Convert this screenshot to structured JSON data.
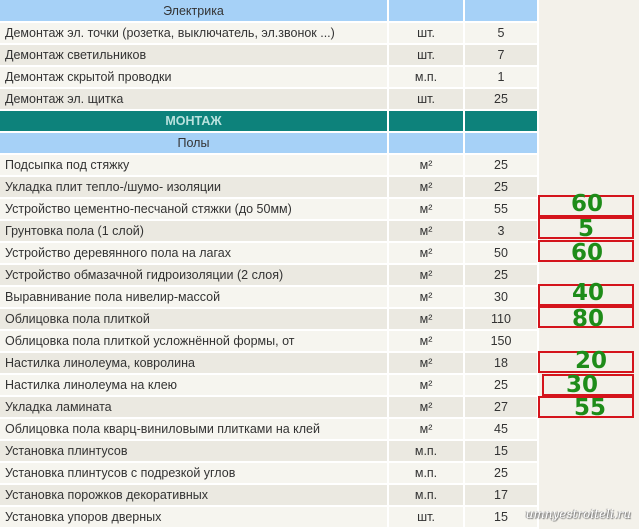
{
  "sections": {
    "electrics": "Электрика",
    "mounting": "МОНТАЖ",
    "floors": "Полы"
  },
  "rows_electrics": [
    {
      "name": "Демонтаж эл. точки (розетка, выключатель, эл.звонок ...)",
      "unit": "шт.",
      "qty": "5"
    },
    {
      "name": "Демонтаж светильников",
      "unit": "шт.",
      "qty": "7"
    },
    {
      "name": "Демонтаж скрытой проводки",
      "unit": "м.п.",
      "qty": "1"
    },
    {
      "name": "Демонтаж эл. щитка",
      "unit": "шт.",
      "qty": "25"
    }
  ],
  "rows_floors": [
    {
      "name": "Подсыпка под стяжку",
      "unit": "м²",
      "qty": "25"
    },
    {
      "name": "Укладка плит тепло-/шумо- изоляции",
      "unit": "м²",
      "qty": "25"
    },
    {
      "name": "Устройство цементно-песчаной стяжки (до 50мм)",
      "unit": "м²",
      "qty": "55"
    },
    {
      "name": "Грунтовка пола (1 слой)",
      "unit": "м²",
      "qty": "3"
    },
    {
      "name": "Устройство деревянного пола на лагах",
      "unit": "м²",
      "qty": "50"
    },
    {
      "name": "Устройство обмазачной гидроизоляции (2 слоя)",
      "unit": "м²",
      "qty": "25"
    },
    {
      "name": "Выравнивание пола нивелир-массой",
      "unit": "м²",
      "qty": "30"
    },
    {
      "name": "Облицовка пола плиткой",
      "unit": "м²",
      "qty": "110"
    },
    {
      "name": "Облицовка пола плиткой усложнённой формы, от",
      "unit": "м²",
      "qty": "150"
    },
    {
      "name": "Настилка линолеума, ковролина",
      "unit": "м²",
      "qty": "18"
    },
    {
      "name": "Настилка линолеума на клею",
      "unit": "м²",
      "qty": "25"
    },
    {
      "name": "Укладка ламината",
      "unit": "м²",
      "qty": "27"
    },
    {
      "name": "Облицовка пола кварц-виниловыми плитками на клей",
      "unit": "м²",
      "qty": "45"
    },
    {
      "name": "Установка плинтусов",
      "unit": "м.п.",
      "qty": "15"
    },
    {
      "name": "Установка плинтусов с подрезкой углов",
      "unit": "м.п.",
      "qty": "25"
    },
    {
      "name": "Установка порожков декоративных",
      "unit": "м.п.",
      "qty": "17"
    },
    {
      "name": "Установка упоров дверных",
      "unit": "шт.",
      "qty": "15"
    }
  ],
  "annotations": [
    "60",
    "5",
    "60",
    "40",
    "80",
    "20",
    "30",
    "55"
  ],
  "colors": {
    "annotation_text": "#1e8c19",
    "annotation_border": "#d4141c",
    "section_header": "#0d827b",
    "subsection_header": "#a6d1f7"
  },
  "watermark": "umnyestroiteli.ru"
}
